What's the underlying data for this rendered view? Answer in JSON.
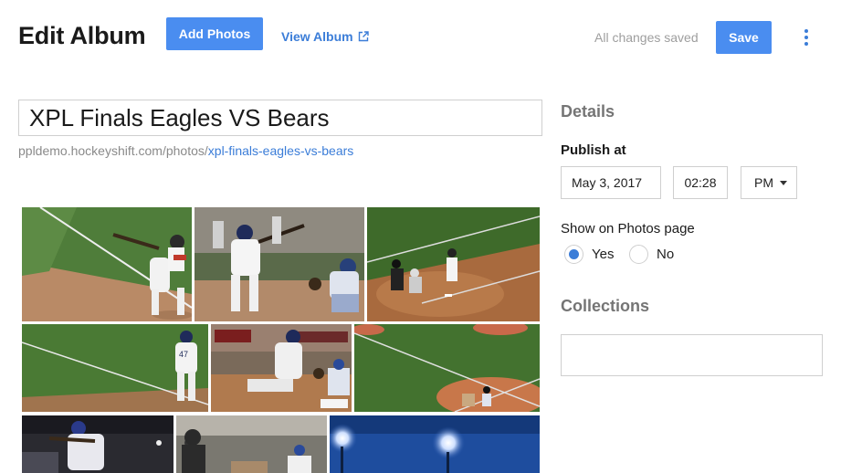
{
  "header": {
    "title": "Edit Album",
    "add_photos_label": "Add Photos",
    "view_album_label": "View Album",
    "status": "All changes saved",
    "save_label": "Save"
  },
  "album": {
    "title_value": "XPL Finals Eagles VS Bears",
    "url_base": "ppldemo.hockeyshift.com/photos/",
    "url_slug": "xpl-finals-eagles-vs-bears"
  },
  "photos": [
    {
      "name": "batter-swing-photo"
    },
    {
      "name": "batter-catcher-photo"
    },
    {
      "name": "home-plate-wide-photo"
    },
    {
      "name": "player-47-field-photo"
    },
    {
      "name": "slide-into-base-photo"
    },
    {
      "name": "infield-wide-photo"
    },
    {
      "name": "bunt-photo"
    },
    {
      "name": "umpire-batter-photo"
    },
    {
      "name": "stadium-lights-photo"
    }
  ],
  "details": {
    "heading": "Details",
    "publish_label": "Publish at",
    "date": "May 3, 2017",
    "time": "02:28",
    "ampm": "PM",
    "show_label": "Show on Photos page",
    "yes_label": "Yes",
    "no_label": "No",
    "show_selected": "Yes",
    "collections_heading": "Collections",
    "collections_value": ""
  },
  "colors": {
    "accent": "#4a8df0",
    "link": "#3b7dd8",
    "muted": "#9e9e9e"
  },
  "icons": {
    "external_link": "external-link-icon",
    "more": "more-vert-icon",
    "dropdown": "caret-down-icon"
  }
}
